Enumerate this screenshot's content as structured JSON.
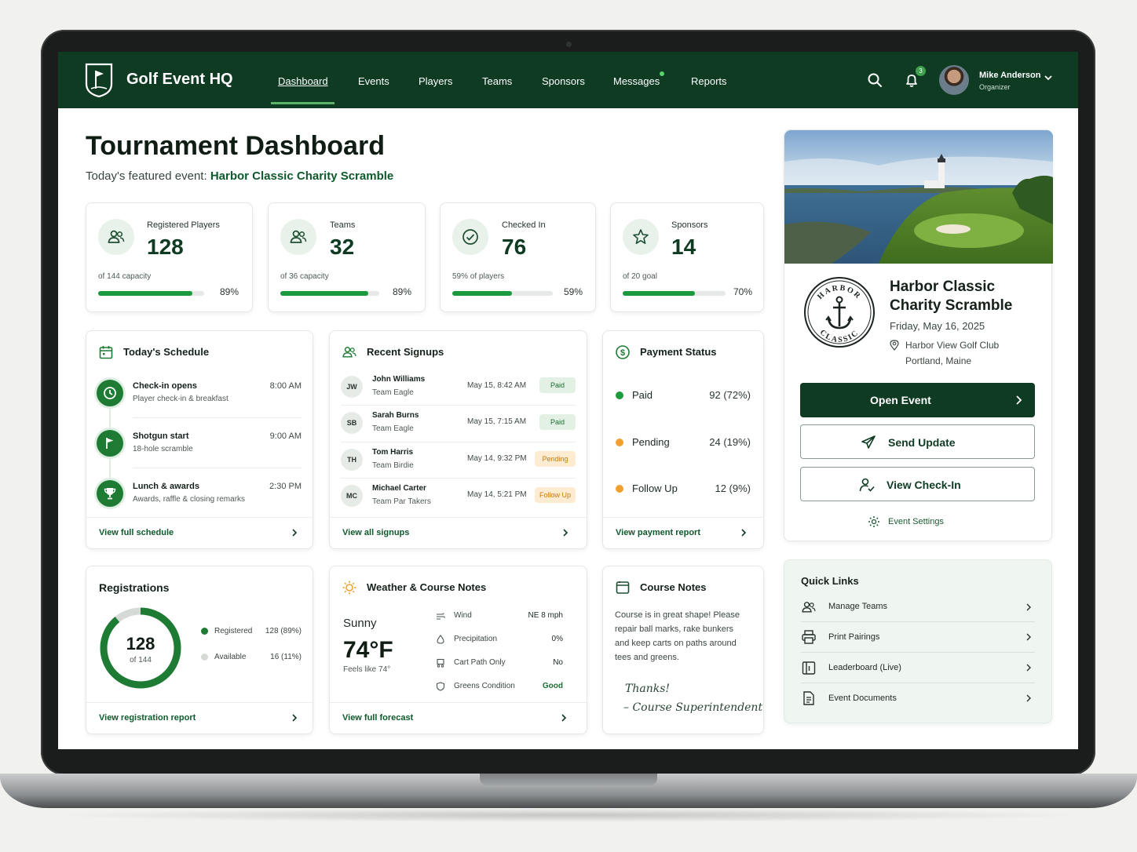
{
  "app": {
    "brand": "Golf Event HQ"
  },
  "nav": {
    "items": [
      "Dashboard",
      "Events",
      "Players",
      "Teams",
      "Sponsors",
      "Messages",
      "Reports"
    ],
    "active": "Dashboard",
    "notification_count": "3"
  },
  "user": {
    "name": "Mike Anderson",
    "role": "Organizer"
  },
  "page": {
    "title": "Tournament Dashboard",
    "featured_prefix": "Today's featured event:",
    "featured_event": "Harbor Classic Charity Scramble"
  },
  "stats": [
    {
      "label": "Registered Players",
      "value": "128",
      "sub": "of 144 capacity",
      "pct_text": "89%",
      "progress": 0.89,
      "icon": "users-icon"
    },
    {
      "label": "Teams",
      "value": "32",
      "sub": "of 36 capacity",
      "pct_text": "89%",
      "progress": 0.89,
      "icon": "users-icon"
    },
    {
      "label": "Checked In",
      "value": "76",
      "sub": "59% of players",
      "pct_text": "59%",
      "progress": 0.59,
      "icon": "check-circle-icon"
    },
    {
      "label": "Sponsors",
      "value": "14",
      "sub": "of 20 goal",
      "pct_text": "70%",
      "progress": 0.7,
      "icon": "star-icon"
    }
  ],
  "schedule": {
    "title": "Today's Schedule",
    "items": [
      {
        "title": "Check-in opens",
        "sub": "Player check-in & breakfast",
        "time": "8:00 AM",
        "icon": "clock-icon"
      },
      {
        "title": "Shotgun start",
        "sub": "18-hole scramble",
        "time": "9:00 AM",
        "icon": "flag-icon"
      },
      {
        "title": "Lunch & awards",
        "sub": "Awards, raffle & closing remarks",
        "time": "2:30 PM",
        "icon": "trophy-icon"
      }
    ],
    "link": "View full schedule"
  },
  "signups": {
    "title": "Recent Signups",
    "rows": [
      {
        "initials": "JW",
        "name": "John Williams",
        "team": "Team Eagle",
        "date": "May 15, 8:42 AM",
        "status": "Paid"
      },
      {
        "initials": "SB",
        "name": "Sarah Burns",
        "team": "Team Eagle",
        "date": "May 15, 7:15 AM",
        "status": "Paid"
      },
      {
        "initials": "TH",
        "name": "Tom Harris",
        "team": "Team Birdie",
        "date": "May 14, 9:32 PM",
        "status": "Pending"
      },
      {
        "initials": "MC",
        "name": "Michael Carter",
        "team": "Team Par Takers",
        "date": "May 14, 5:21 PM",
        "status": "Follow Up"
      }
    ],
    "link": "View all signups"
  },
  "payment": {
    "title": "Payment Status",
    "rows": [
      {
        "label": "Paid",
        "value": "92  (72%)",
        "color": "#1f9a3d"
      },
      {
        "label": "Pending",
        "value": "24  (19%)",
        "color": "#f0a030"
      },
      {
        "label": "Follow Up",
        "value": "12  (9%)",
        "color": "#f0a030"
      }
    ],
    "link": "View payment report"
  },
  "registrations": {
    "title": "Registrations",
    "total": "128",
    "total_sub": "of 144",
    "registered_fraction": 0.89,
    "legend": [
      {
        "label": "Registered",
        "value": "128  (89%)",
        "color": "#1e7b34"
      },
      {
        "label": "Available",
        "value": "16  (11%)",
        "color": "#d6dad7"
      }
    ],
    "link": "View registration report"
  },
  "weather": {
    "title": "Weather & Course Notes",
    "condition": "Sunny",
    "temp": "74°F",
    "feels": "Feels like 74°",
    "rows": [
      {
        "label": "Wind",
        "value": "NE 8 mph",
        "icon": "wind-icon"
      },
      {
        "label": "Precipitation",
        "value": "0%",
        "icon": "droplet-icon"
      },
      {
        "label": "Cart Path Only",
        "value": "No",
        "icon": "cart-icon"
      },
      {
        "label": "Greens Condition",
        "value": "Good",
        "icon": "shield-icon"
      }
    ],
    "link": "View full forecast"
  },
  "course_notes": {
    "title": "Course Notes",
    "text": "Course is in great shape! Please repair ball marks, rake bunkers and keep carts on paths around tees and greens.",
    "sig_line1": "Thanks!",
    "sig_line2": "– Course Superintendent"
  },
  "event": {
    "name": "Harbor Classic Charity Scramble",
    "date": "Friday, May 16, 2025",
    "venue": "Harbor View Golf Club",
    "city": "Portland, Maine",
    "seal_top": "HARBOR",
    "seal_bottom": "CLASSIC",
    "open_label": "Open Event",
    "send_label": "Send Update",
    "checkin_label": "View Check-In",
    "settings_label": "Event Settings"
  },
  "quick_links": {
    "title": "Quick Links",
    "items": [
      {
        "label": "Manage Teams",
        "icon": "users-icon"
      },
      {
        "label": "Print Pairings",
        "icon": "printer-icon"
      },
      {
        "label": "Leaderboard (Live)",
        "icon": "leaderboard-icon"
      },
      {
        "label": "Event Documents",
        "icon": "document-icon"
      }
    ]
  },
  "colors": {
    "brand": "#0e3b22",
    "accent": "#1a9a3c",
    "warning": "#f0a030"
  }
}
